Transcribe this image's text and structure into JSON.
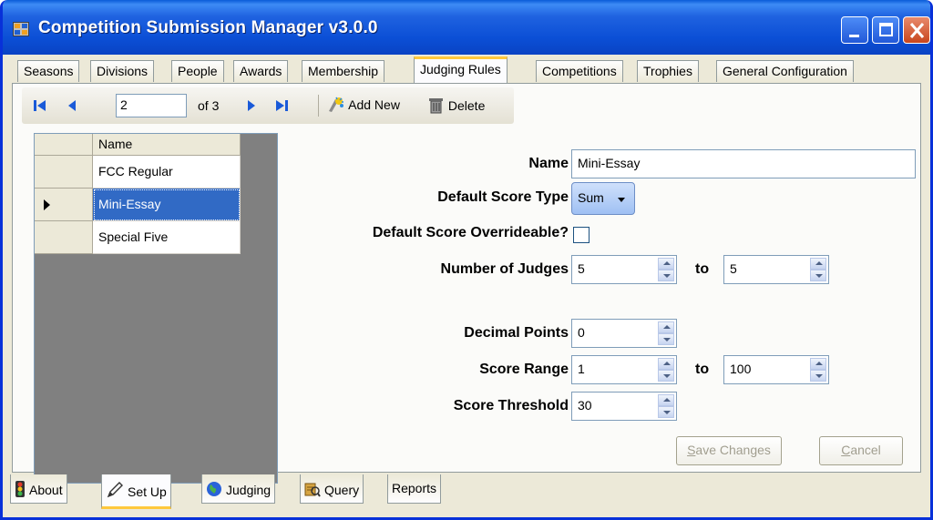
{
  "window": {
    "title": "Competition Submission Manager v3.0.0"
  },
  "top_tabs": [
    {
      "label": "Seasons",
      "active": false
    },
    {
      "label": "Divisions",
      "active": false
    },
    {
      "label": "People",
      "active": false
    },
    {
      "label": "Awards",
      "active": false
    },
    {
      "label": "Membership",
      "active": false
    },
    {
      "label": "Judging Rules",
      "active": true
    },
    {
      "label": "Competitions",
      "active": false
    },
    {
      "label": "Trophies",
      "active": false
    },
    {
      "label": "General Configuration",
      "active": false
    }
  ],
  "navigator": {
    "position": "2",
    "of_label": "of 3",
    "add_new_label": "Add New",
    "delete_label": "Delete"
  },
  "grid": {
    "column_header": "Name",
    "rows": [
      "FCC Regular",
      "Mini-Essay",
      "Special Five"
    ],
    "selected_index": 1
  },
  "form": {
    "name_label": "Name",
    "name_value": "Mini-Essay",
    "score_type_label": "Default Score Type",
    "score_type_value": "Sum",
    "overrideable_label": "Default Score Overrideable?",
    "overrideable_checked": false,
    "judges_label": "Number of Judges",
    "judges_min": "5",
    "judges_to": "to",
    "judges_max": "5",
    "decimal_label": "Decimal Points",
    "decimal_value": "0",
    "range_label": "Score Range",
    "range_min": "1",
    "range_to": "to",
    "range_max": "100",
    "threshold_label": "Score Threshold",
    "threshold_value": "30"
  },
  "buttons": {
    "save_prefix": "S",
    "save_rest": "ave Changes",
    "cancel_prefix": "C",
    "cancel_rest": "ancel"
  },
  "bottom_tabs": [
    {
      "label": "About",
      "icon": "traffic-light-icon",
      "active": false
    },
    {
      "label": "Set Up",
      "icon": "pencil-icon",
      "active": true
    },
    {
      "label": "Judging",
      "icon": "globe-icon",
      "active": false
    },
    {
      "label": "Query",
      "icon": "query-icon",
      "active": false
    },
    {
      "label": "Reports",
      "icon": "",
      "active": false
    }
  ],
  "colors": {
    "titlebar": "#0a4fd6",
    "selection": "#316ac5",
    "active_tab_accent": "#ffc83c"
  }
}
